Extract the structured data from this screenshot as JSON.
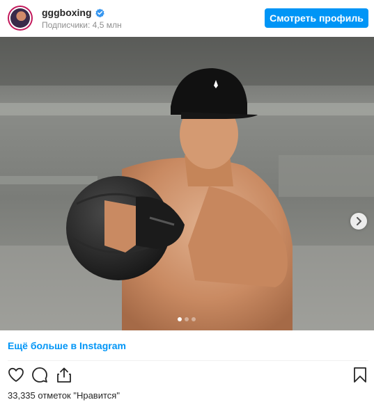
{
  "header": {
    "username": "gggboxing",
    "followers": "Подписчики: 4,5 млн",
    "profile_button": "Смотреть профиль",
    "avatar_icon": "profile-avatar",
    "verified_icon": "verified-badge-icon"
  },
  "media": {
    "description_icon": "post-photo",
    "carousel_dots": 3,
    "active_dot": 1,
    "next_icon": "chevron-right-icon"
  },
  "more_link": "Ещё больше в Instagram",
  "actions": {
    "like_icon": "heart-icon",
    "comment_icon": "comment-icon",
    "share_icon": "share-icon",
    "save_icon": "bookmark-icon"
  },
  "likes_text": "33,335 отметок \"Нравится\"",
  "colors": {
    "accent": "#0095f6",
    "text": "#262626",
    "muted": "#8e8e8e"
  }
}
